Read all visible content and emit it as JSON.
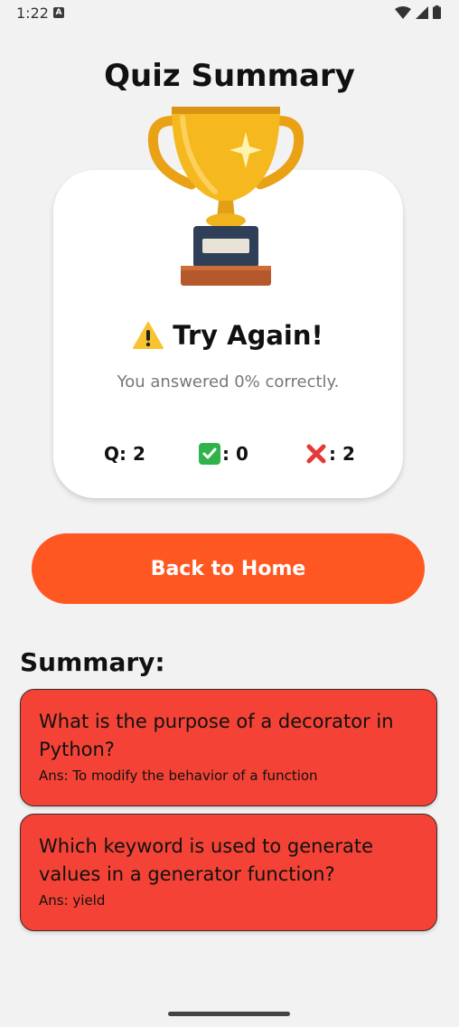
{
  "status_bar": {
    "time": "1:22",
    "notification_letter": "A",
    "icons": [
      "wifi-icon",
      "signal-icon",
      "battery-icon"
    ]
  },
  "page": {
    "title": "Quiz Summary"
  },
  "result": {
    "icon": "trophy-icon",
    "heading_icon": "warning-icon",
    "heading": "Try Again!",
    "subtext": "You answered 0% correctly.",
    "stats": {
      "questions_label": "Q: 2",
      "correct_label": ": 0",
      "wrong_label": ": 2"
    }
  },
  "actions": {
    "back_label": "Back to Home"
  },
  "summary": {
    "heading": "Summary:",
    "items": [
      {
        "question": "What is the purpose of a decorator in Python?",
        "answer": "Ans: To modify the behavior of a function"
      },
      {
        "question": "Which keyword is used to generate values in a generator function?",
        "answer": "Ans: yield"
      }
    ]
  },
  "colors": {
    "background": "#f2f2f2",
    "accent": "#ff5722",
    "wrong_item": "#f44336",
    "correct": "#2fb34a"
  }
}
